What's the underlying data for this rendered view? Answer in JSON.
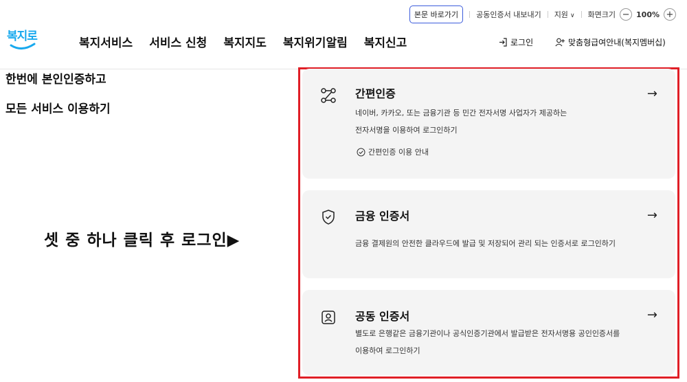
{
  "utility": {
    "skip_link": "본문 바로가기",
    "export_cert": "공동인증서 내보내기",
    "support": "지원",
    "screen_size": "화면크기",
    "zoom_minus": "−",
    "zoom_value": "100%",
    "zoom_plus": "+"
  },
  "header": {
    "logo_text": "복지로",
    "nav": [
      "복지서비스",
      "서비스 신청",
      "복지지도",
      "복지위기알림",
      "복지신고"
    ],
    "login_label": "로그인",
    "member_label": "맞춤형급여안내(복지멤버십)"
  },
  "intro": {
    "line1": "한번에 본인인증하고",
    "line2": "모든 서비스 이용하기"
  },
  "annotation": "셋 중 하나 클릭 후 로그인▶",
  "cards": [
    {
      "title": "간편인증",
      "desc_line1": "네이버, 카카오, 또는 금융기관 등 민간 전자서명 사업자가 제공하는",
      "desc_line2": "전자서명을 이용하여 로그인하기",
      "guide": "간편인증 이용 안내",
      "icon": "route-icon"
    },
    {
      "title": "금융 인증서",
      "desc_line1": "금융 결제원의 안전한 클라우드에 발급 및 저장되어 관리 되는 인증서로 로그인하기",
      "icon": "shield-check-icon"
    },
    {
      "title": "공동 인증서",
      "desc_line1": "별도로 은행같은 금융기관이나 공식인증기관에서 발급받은 전자서명용 공인인증서를",
      "desc_line2": "이용하여 로그인하기",
      "icon": "user-badge-icon"
    }
  ],
  "colors": {
    "accent": "#18a9ee",
    "frame": "#e01e26",
    "card_bg": "#f4f4f4"
  }
}
